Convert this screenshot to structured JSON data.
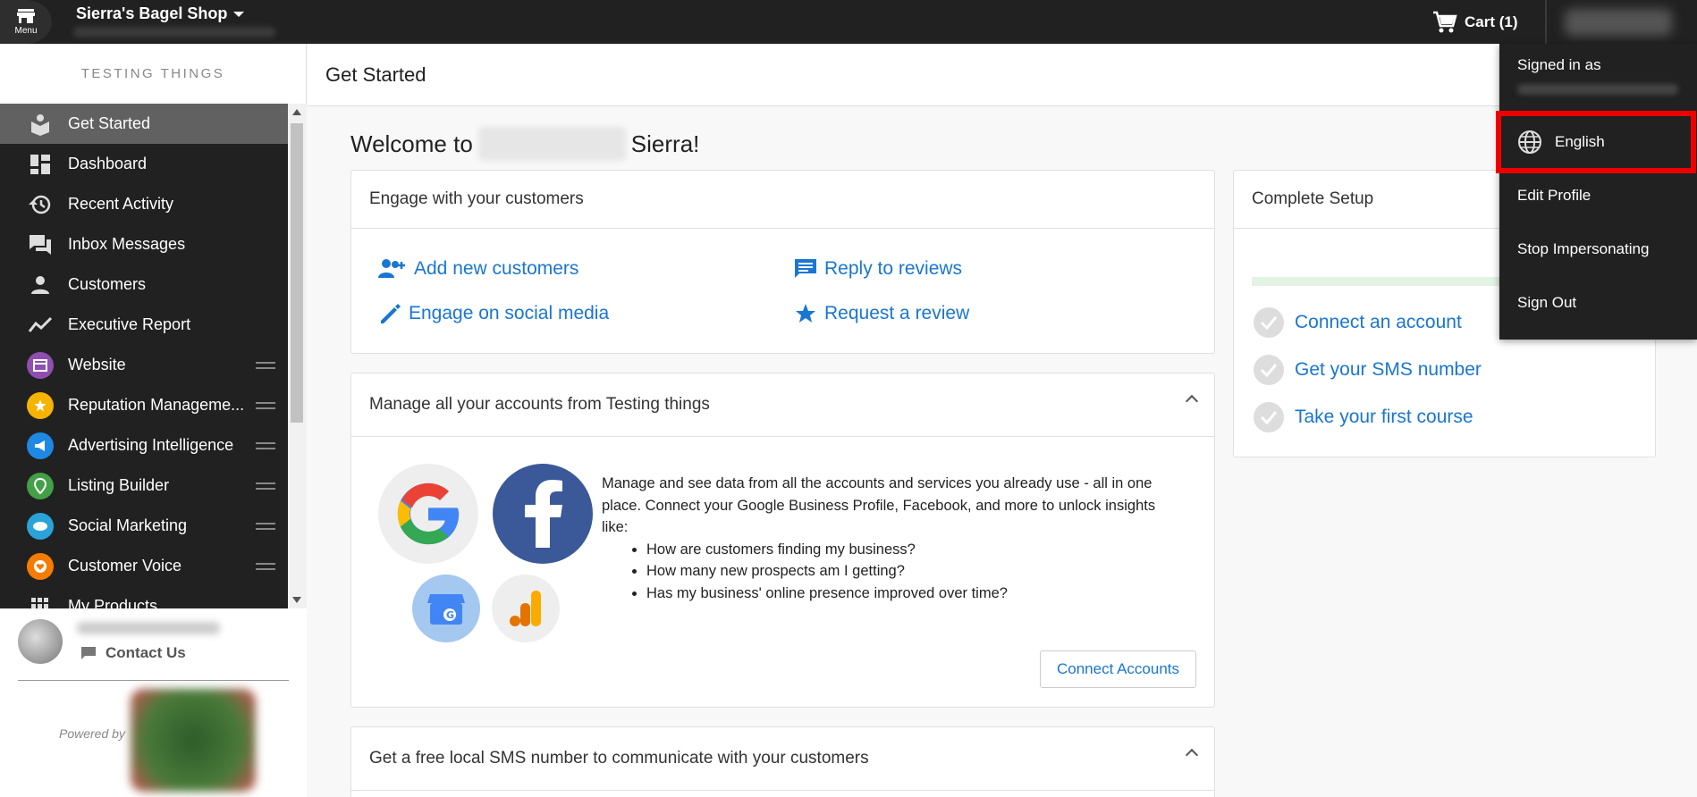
{
  "topbar": {
    "menu_label": "Menu",
    "shop_name": "Sierra's Bagel Shop",
    "cart_label": "Cart (1)"
  },
  "sidebar": {
    "heading": "TESTING THINGS",
    "items": [
      {
        "label": "Get Started",
        "icon": "get-started-icon"
      },
      {
        "label": "Dashboard",
        "icon": "dashboard-icon"
      },
      {
        "label": "Recent Activity",
        "icon": "history-icon"
      },
      {
        "label": "Inbox Messages",
        "icon": "chat-icon"
      },
      {
        "label": "Customers",
        "icon": "person-icon"
      },
      {
        "label": "Executive Report",
        "icon": "trend-icon"
      },
      {
        "label": "Website",
        "icon": "website-icon"
      },
      {
        "label": "Reputation Manageme...",
        "icon": "star-icon"
      },
      {
        "label": "Advertising Intelligence",
        "icon": "megaphone-icon"
      },
      {
        "label": "Listing Builder",
        "icon": "pin-icon"
      },
      {
        "label": "Social Marketing",
        "icon": "social-icon"
      },
      {
        "label": "Customer Voice",
        "icon": "heart-icon"
      },
      {
        "label": "My Products",
        "icon": "grid-icon"
      }
    ],
    "contact_label": "Contact Us",
    "powered_by": "Powered by"
  },
  "main": {
    "page_title": "Get Started",
    "welcome_prefix": "Welcome to",
    "welcome_name": "Sierra!",
    "engage_card": {
      "title": "Engage with your customers",
      "actions": [
        "Add new customers",
        "Reply to reviews",
        "Engage on social media",
        "Request a review"
      ]
    },
    "accounts_card": {
      "title": "Manage all your accounts from Testing things",
      "description": "Manage and see data from all the accounts and services you already use - all in one place. Connect your Google Business Profile, Facebook, and more to unlock insights like:",
      "bullets": [
        "How are customers finding my business?",
        "How many new prospects am I getting?",
        "Has my business' online presence improved over time?"
      ],
      "button": "Connect Accounts"
    },
    "sms_card": {
      "title": "Get a free local SMS number to communicate with your customers"
    },
    "setup_card": {
      "title": "Complete Setup",
      "progress": 0,
      "steps": [
        "Connect an account",
        "Get your SMS number",
        "Take your first course"
      ]
    }
  },
  "dropdown": {
    "signed_in_as": "Signed in as",
    "language": "English",
    "edit_profile": "Edit Profile",
    "stop_impersonating": "Stop Impersonating",
    "sign_out": "Sign Out"
  },
  "colors": {
    "accent": "#1976d2",
    "topbar": "#212121",
    "highlight": "#e00000"
  }
}
